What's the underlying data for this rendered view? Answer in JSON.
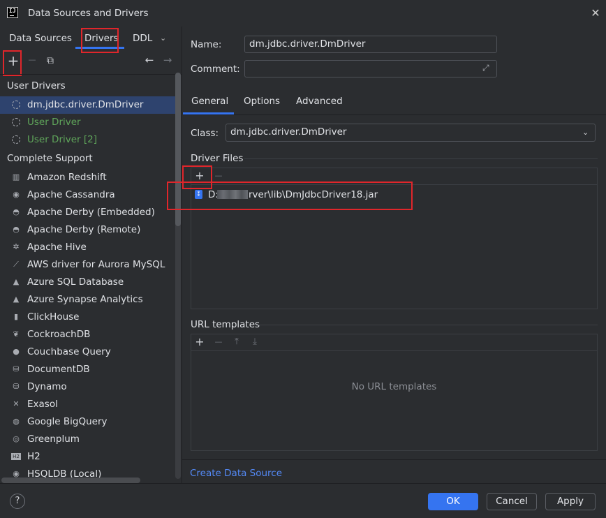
{
  "window": {
    "title": "Data Sources and Drivers",
    "close": "✕"
  },
  "left_tabs": [
    "Data Sources",
    "Drivers",
    "DDL"
  ],
  "left_toolbar": {
    "add": "+",
    "remove": "—",
    "copy": "⧉",
    "back": "←",
    "forward": "→"
  },
  "user_drivers": {
    "heading": "User Drivers",
    "items": [
      "dm.jdbc.driver.DmDriver",
      "User Driver",
      "User Driver [2]"
    ]
  },
  "complete_support": {
    "heading": "Complete Support",
    "items": [
      "Amazon Redshift",
      "Apache Cassandra",
      "Apache Derby (Embedded)",
      "Apache Derby (Remote)",
      "Apache Hive",
      "AWS driver for Aurora MySQL",
      "Azure SQL Database",
      "Azure Synapse Analytics",
      "ClickHouse",
      "CockroachDB",
      "Couchbase Query",
      "DocumentDB",
      "Dynamo",
      "Exasol",
      "Google BigQuery",
      "Greenplum",
      "H2",
      "HSQLDB (Local)"
    ]
  },
  "form": {
    "name_label": "Name:",
    "name_value": "dm.jdbc.driver.DmDriver",
    "comment_label": "Comment:",
    "comment_value": ""
  },
  "right_tabs": [
    "General",
    "Options",
    "Advanced"
  ],
  "general": {
    "class_label": "Class:",
    "class_value": "dm.jdbc.driver.DmDriver",
    "driver_files_label": "Driver Files",
    "driver_file_prefix": "D:\\",
    "driver_file_suffix": "rver\\lib\\DmJdbcDriver18.jar",
    "url_templates_label": "URL templates",
    "url_templates_empty": "No URL templates",
    "create_link": "Create Data Source"
  },
  "footer": {
    "help": "?",
    "ok": "OK",
    "cancel": "Cancel",
    "apply": "Apply"
  },
  "colors": {
    "accent": "#3574f0",
    "highlight_box": "#e0262b",
    "user_driver_green": "#5fa55a",
    "link": "#548af7"
  }
}
